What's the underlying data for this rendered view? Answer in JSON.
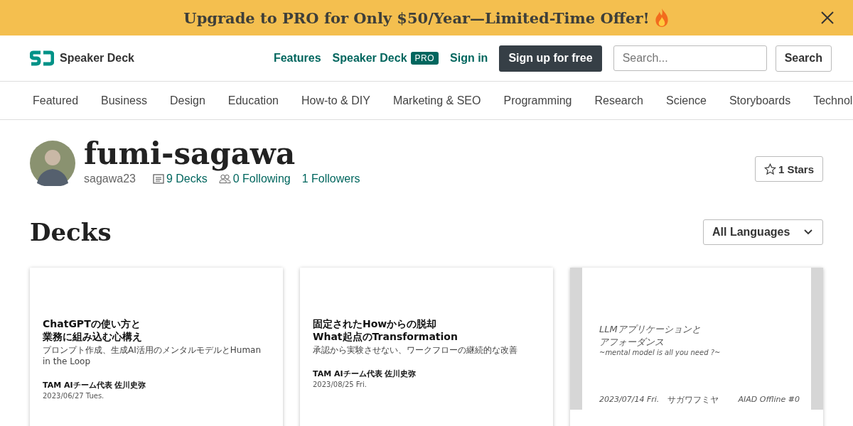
{
  "banner": {
    "text": "Upgrade to PRO for Only $50/Year—Limited-Time Offer!"
  },
  "header": {
    "logo_text": "Speaker Deck",
    "nav": [
      {
        "label": "Features",
        "kind": "link"
      },
      {
        "label": "Speaker Deck",
        "kind": "pro",
        "badge": "PRO"
      },
      {
        "label": "Sign in",
        "kind": "link"
      },
      {
        "label": "Sign up for free",
        "kind": "primary"
      }
    ],
    "search": {
      "placeholder": "Search...",
      "button": "Search"
    }
  },
  "categories": [
    {
      "label": "Featured"
    },
    {
      "label": "Business"
    },
    {
      "label": "Design"
    },
    {
      "label": "Education"
    },
    {
      "label": "How-to & DIY"
    },
    {
      "label": "Marketing & SEO"
    },
    {
      "label": "Programming"
    },
    {
      "label": "Research"
    },
    {
      "label": "Science"
    },
    {
      "label": "Storyboards"
    },
    {
      "label": "Technol"
    }
  ],
  "profile": {
    "name": "fumi-sagawa",
    "username": "sagawa23",
    "stats": [
      {
        "kind": "decks",
        "label": "9 Decks"
      },
      {
        "kind": "following",
        "label": "0 Following"
      },
      {
        "kind": "followers",
        "label": "1 Followers"
      }
    ],
    "stars_button": "1 Stars"
  },
  "decks": {
    "heading": "Decks",
    "language_filter": "All Languages",
    "items": [
      {
        "kind": "gothic",
        "title_lines": [
          "ChatGPTの使い方と",
          "業務に組み込む心構え"
        ],
        "subtitle": "プロンプト作成、生成AI活用のメンタルモデルとHuman in the Loop",
        "author": "TAM AIチーム代表 佐川史弥",
        "date": "2023/06/27 Tues."
      },
      {
        "kind": "gothic",
        "title_lines": [
          "固定されたHowからの脱却",
          "What起点のTransformation"
        ],
        "subtitle": "承認から実験させない、ワークフローの継続的な改善",
        "author": "TAM AIチーム代表 佐川史弥",
        "date": "2023/08/25 Fri."
      },
      {
        "kind": "handwritten",
        "title_lines": [
          "LLMアプリケーションと",
          "アフォーダンス"
        ],
        "subtitle": "~mental model is all you need ?~",
        "author": "サガワフミヤ",
        "date": "2023/07/14 Fri.",
        "event": "AIAD Offline #0"
      }
    ]
  }
}
